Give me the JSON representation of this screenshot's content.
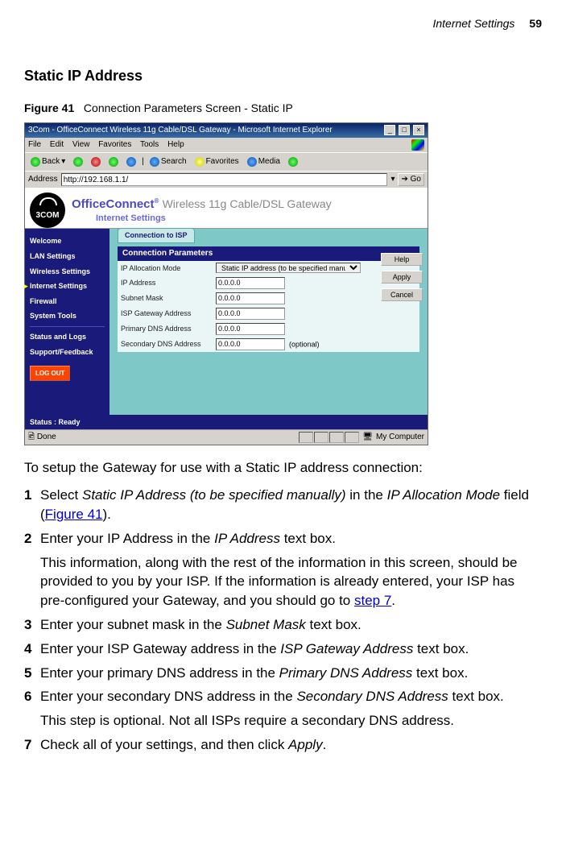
{
  "header": {
    "running": "Internet Settings",
    "page": "59"
  },
  "section_title": "Static IP Address",
  "figure": {
    "num": "Figure 41",
    "caption": "Connection Parameters Screen - Static IP"
  },
  "ie": {
    "title": "3Com - OfficeConnect Wireless 11g Cable/DSL Gateway - Microsoft Internet Explorer",
    "menus": [
      "File",
      "Edit",
      "View",
      "Favorites",
      "Tools",
      "Help"
    ],
    "toolbar": {
      "back": "Back",
      "search": "Search",
      "favorites": "Favorites",
      "media": "Media"
    },
    "address_label": "Address",
    "address_value": "http://192.168.1.1/",
    "go": "Go",
    "status_done": "Done",
    "status_zone": "My Computer"
  },
  "brand": {
    "logo": "3COM",
    "product1": "OfficeConnect",
    "product2": "Wireless 11g Cable/DSL Gateway",
    "subtitle": "Internet Settings"
  },
  "sidebar": {
    "items": [
      "Welcome",
      "LAN Settings",
      "Wireless Settings",
      "Internet Settings",
      "Firewall",
      "System Tools"
    ],
    "items2": [
      "Status and Logs",
      "Support/Feedback"
    ],
    "logout": "LOG OUT"
  },
  "tab": "Connection to ISP",
  "params": {
    "title": "Connection Parameters",
    "rows": {
      "mode_label": "IP Allocation Mode",
      "mode_value": "Static IP address (to be specified manually)",
      "ip_label": "IP Address",
      "ip_value": "0.0.0.0",
      "mask_label": "Subnet Mask",
      "mask_value": "0.0.0.0",
      "gw_label": "ISP Gateway Address",
      "gw_value": "0.0.0.0",
      "dns1_label": "Primary DNS Address",
      "dns1_value": "0.0.0.0",
      "dns2_label": "Secondary DNS Address",
      "dns2_value": "0.0.0.0",
      "optional": "(optional)"
    }
  },
  "buttons": {
    "help": "Help",
    "apply": "Apply",
    "cancel": "Cancel"
  },
  "status_strip": "Status : Ready",
  "intro": "To setup the Gateway for use with a Static IP address connection:",
  "steps": {
    "s1a": "Select ",
    "s1b": "Static IP Address (to be specified manually)",
    "s1c": " in the ",
    "s1d": "IP Allocation Mode",
    "s1e": " field (",
    "s1link": "Figure 41",
    "s1f": ").",
    "s2a": "Enter your IP Address in the ",
    "s2b": "IP Address",
    "s2c": " text box.",
    "s2p1": "This information, along with the rest of the information in this screen, should be provided to you by your ISP. If the information is already entered, your ISP has pre-configured your Gateway, and you should go to ",
    "s2link": "step 7",
    "s2p2": ".",
    "s3a": "Enter your subnet mask in the ",
    "s3b": "Subnet Mask",
    "s3c": " text box.",
    "s4a": "Enter your ISP Gateway address in the ",
    "s4b": "ISP Gateway Address",
    "s4c": " text box.",
    "s5a": "Enter your primary DNS address in the ",
    "s5b": "Primary DNS Address",
    "s5c": " text box.",
    "s6a": "Enter your secondary DNS address in the ",
    "s6b": "Secondary DNS Address",
    "s6c": " text box.",
    "s6p": "This step is optional. Not all ISPs require a secondary DNS address.",
    "s7a": "Check all of your settings, and then click ",
    "s7b": "Apply",
    "s7c": "."
  },
  "nums": {
    "n1": "1",
    "n2": "2",
    "n3": "3",
    "n4": "4",
    "n5": "5",
    "n6": "6",
    "n7": "7"
  }
}
